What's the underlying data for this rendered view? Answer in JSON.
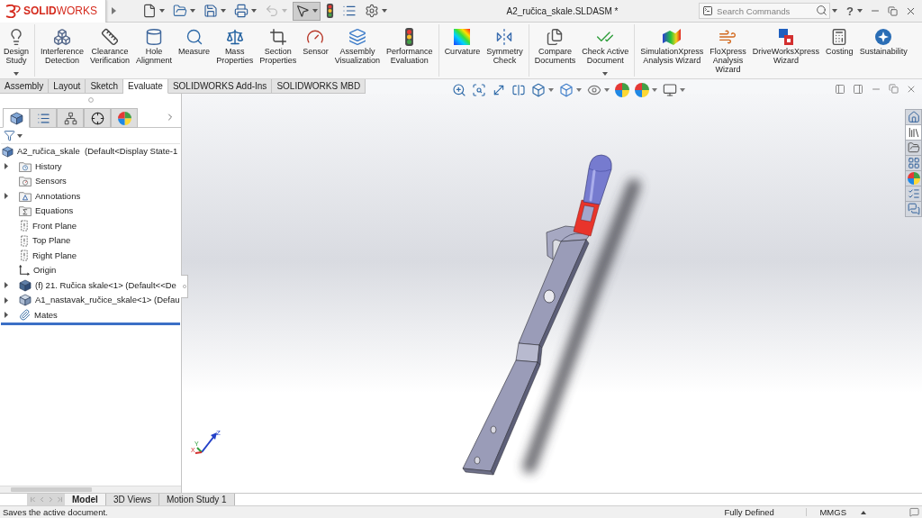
{
  "title_bar": {
    "logo": "**SOLID**WORKS",
    "quick_access": [
      {
        "dropdown": true,
        "disabled": false,
        "selected": false
      },
      {
        "dropdown": true,
        "disabled": false,
        "selected": false
      },
      {
        "dropdown": true,
        "disabled": false,
        "selected": false
      },
      {
        "dropdown": true,
        "disabled": false,
        "selected": false
      },
      {
        "dropdown": true,
        "disabled": true,
        "selected": false
      },
      {
        "dropdown": true,
        "disabled": false,
        "selected": true
      },
      {
        "dropdown": false,
        "disabled": false,
        "selected": false
      },
      {
        "dropdown": false,
        "disabled": false,
        "selected": false
      },
      {
        "dropdown": true,
        "disabled": false,
        "selected": false
      }
    ],
    "document_title": "A2_ručica_skale.SLDASM *",
    "search": {
      "placeholder": "Search Commands"
    },
    "help": "?"
  },
  "ribbon": {
    "groups": [
      {
        "buttons": [
          {
            "lines": [
              "Design",
              "Study"
            ],
            "dropdown": true
          }
        ]
      },
      {
        "buttons": [
          {
            "lines": [
              "Interference",
              "Detection"
            ],
            "dropdown": false
          },
          {
            "lines": [
              "Clearance",
              "Verification"
            ],
            "dropdown": false
          },
          {
            "lines": [
              "Hole",
              "Alignment"
            ],
            "dropdown": false
          },
          {
            "lines": [
              "Measure"
            ],
            "dropdown": false
          },
          {
            "lines": [
              "Mass",
              "Properties"
            ],
            "dropdown": false
          },
          {
            "lines": [
              "Section",
              "Properties"
            ],
            "dropdown": false
          },
          {
            "lines": [
              "Sensor"
            ],
            "dropdown": false
          },
          {
            "lines": [
              "Assembly",
              "Visualization"
            ],
            "dropdown": false
          },
          {
            "lines": [
              "Performance",
              "Evaluation"
            ],
            "dropdown": false
          }
        ]
      },
      {
        "buttons": [
          {
            "lines": [
              "Curvature"
            ],
            "dropdown": false
          },
          {
            "lines": [
              "Symmetry",
              "Check"
            ],
            "dropdown": false
          }
        ]
      },
      {
        "buttons": [
          {
            "lines": [
              "Compare",
              "Documents"
            ],
            "dropdown": false
          },
          {
            "lines": [
              "Check Active",
              "Document"
            ],
            "dropdown": true
          }
        ]
      },
      {
        "buttons": [
          {
            "lines": [
              "SimulationXpress",
              "Analysis Wizard"
            ],
            "dropdown": false
          },
          {
            "lines": [
              "FloXpress",
              "Analysis",
              "Wizard"
            ],
            "dropdown": false
          },
          {
            "lines": [
              "DriveWorksXpress",
              "Wizard"
            ],
            "dropdown": false
          },
          {
            "lines": [
              "Costing"
            ],
            "dropdown": false
          },
          {
            "lines": [
              "Sustainability"
            ],
            "dropdown": false
          }
        ]
      }
    ]
  },
  "command_tabs": [
    {
      "label": "Assembly",
      "selected": false
    },
    {
      "label": "Layout",
      "selected": false
    },
    {
      "label": "Sketch",
      "selected": false
    },
    {
      "label": "Evaluate",
      "selected": true
    },
    {
      "label": "SOLIDWORKS Add-Ins",
      "selected": false
    },
    {
      "label": "SOLIDWORKS MBD",
      "selected": false
    }
  ],
  "heads_up_toolbar": [
    {
      "dropdown": false
    },
    {
      "dropdown": false
    },
    {
      "dropdown": false
    },
    {
      "dropdown": false
    },
    {
      "dropdown": true
    },
    {
      "dropdown": true
    },
    {
      "dropdown": true
    },
    {
      "dropdown": false
    },
    {
      "dropdown": true
    },
    {
      "dropdown": true
    }
  ],
  "feature_manager": {
    "tabs": [
      {
        "selected": true
      },
      {
        "selected": false
      },
      {
        "selected": false
      },
      {
        "selected": false
      },
      {
        "selected": false
      }
    ],
    "tree": {
      "label": "A2_ručica_skale  (Default<Display State-1",
      "kind": "assembly",
      "children": [
        {
          "label": "History",
          "kind": "history",
          "has_children": true
        },
        {
          "label": "Sensors",
          "kind": "sensors",
          "has_children": false
        },
        {
          "label": "Annotations",
          "kind": "annotations",
          "has_children": true
        },
        {
          "label": "Equations",
          "kind": "equations",
          "has_children": false
        },
        {
          "label": "Front Plane",
          "kind": "plane",
          "has_children": false
        },
        {
          "label": "Top Plane",
          "kind": "plane",
          "has_children": false
        },
        {
          "label": "Right Plane",
          "kind": "plane",
          "has_children": false
        },
        {
          "label": "Origin",
          "kind": "origin",
          "has_children": false
        },
        {
          "label": "(f) 21. Ručica skale<1> (Default<<De",
          "kind": "part",
          "has_children": true
        },
        {
          "label": "A1_nastavak_ručice_skale<1> (Defau",
          "kind": "component",
          "has_children": true
        },
        {
          "label": "Mates",
          "kind": "mates",
          "has_children": true
        }
      ]
    }
  },
  "task_pane": [
    {
      "selected": false
    },
    {
      "selected": true
    },
    {
      "selected": false
    },
    {
      "selected": false
    },
    {
      "selected": false
    },
    {
      "selected": false
    },
    {
      "selected": false
    }
  ],
  "triad": {
    "x": "X",
    "y": "Y",
    "z": "Z"
  },
  "bottom_tabs": [
    {
      "label": "Model",
      "selected": true
    },
    {
      "label": "3D Views",
      "selected": false
    },
    {
      "label": "Motion Study 1",
      "selected": false
    }
  ],
  "status_bar": {
    "message": "Saves the active document.",
    "state": "Fully Defined",
    "units": "MMGS"
  }
}
